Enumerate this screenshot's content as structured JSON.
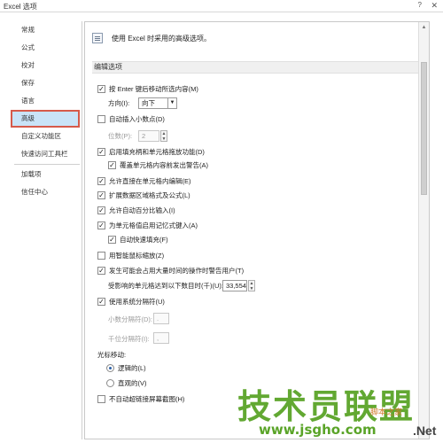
{
  "window": {
    "title": "Excel 选项",
    "help": "?",
    "close": "✕"
  },
  "sidebar": {
    "items": [
      {
        "label": "常规"
      },
      {
        "label": "公式"
      },
      {
        "label": "校对"
      },
      {
        "label": "保存"
      },
      {
        "label": "语言"
      },
      {
        "label": "高级",
        "selected": true
      },
      {
        "label": "自定义功能区"
      },
      {
        "label": "快速访问工具栏"
      },
      {
        "label": "加载项"
      },
      {
        "label": "信任中心"
      }
    ]
  },
  "content": {
    "header": "使用 Excel 时采用的高级选项。",
    "section_title": "编辑选项",
    "options": {
      "move_after_enter": "按 Enter 键后移动所选内容(M)",
      "direction_label": "方向(I):",
      "direction_value": "向下",
      "auto_decimal": "自动插入小数点(D)",
      "places_label": "位数(P):",
      "places_value": "2",
      "fill_handle": "启用填充柄和单元格拖放功能(D)",
      "overwrite_alert": "覆盖单元格内容前发出警告(A)",
      "edit_in_cell": "允许直接在单元格内编辑(E)",
      "extend_formats": "扩展数据区域格式及公式(L)",
      "auto_percent": "允许自动百分比输入(I)",
      "autocomplete": "为单元格值启用记忆式键入(A)",
      "flash_fill": "自动快速填充(F)",
      "intellimouse_zoom": "用智能鼠标缩放(Z)",
      "alert_slow": "发生可能会占用大量时间的操作时警告用户(T)",
      "cells_threshold_label": "受影响的单元格达到以下数目时(千)(U):",
      "cells_threshold_value": "33,554",
      "system_separators": "使用系统分隔符(U)",
      "decimal_sep_label": "小数分隔符(D):",
      "decimal_sep_value": ".",
      "thousands_sep_label": "千位分隔符(I):",
      "thousands_sep_value": ",",
      "cursor_movement": "光标移动:",
      "logical": "逻辑的(L)",
      "visual": "直观的(V)",
      "no_screenshot_hyperlink": "不自动超链接屏幕截图(H)"
    }
  },
  "watermark": {
    "brand": "技术员联盟",
    "url": "www.jsgho.com",
    "small": "脚本之家",
    "net": ".Net"
  }
}
